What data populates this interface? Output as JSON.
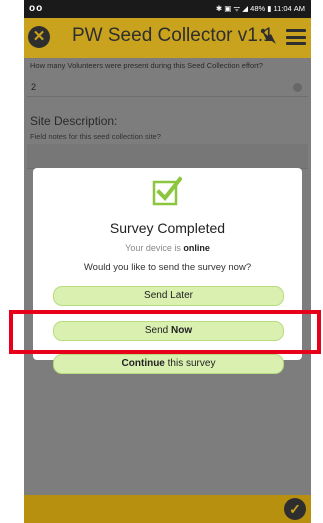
{
  "status_bar": {
    "left_icons": "oo",
    "right_text": "✱ ▣ ᯤ ◢ 48% ▮ 11:04 AM"
  },
  "app_bar": {
    "title": "PW Seed Collector v1.1",
    "close_icon": "close-icon",
    "tool_icon": "tool-icon",
    "menu_icon": "hamburger-menu-icon",
    "accent_color": "#c9a31e"
  },
  "form": {
    "volunteers_question": "How many Volunteers were present during this Seed Collection effort?",
    "volunteers_value": "2",
    "site_description_label": "Site Description:",
    "site_description_hint": "Field notes for this seed collection site?"
  },
  "dialog": {
    "title": "Survey Completed",
    "status_prefix": "Your device is ",
    "status_value": "online",
    "question": "Would you like to send the survey now?",
    "send_later_label": "Send Later",
    "send_now_prefix": "Send ",
    "send_now_bold": "Now",
    "continue_bold": "Continue",
    "continue_suffix": " this survey",
    "button_color": "#d9f0b0",
    "icon_color": "#8cc63f"
  },
  "annotation": {
    "highlight_color": "#e8001a"
  },
  "footer": {
    "check_icon": "checkmark-icon"
  }
}
